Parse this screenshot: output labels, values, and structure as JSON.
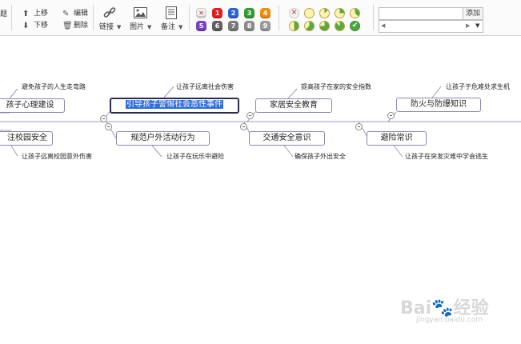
{
  "toolbar": {
    "cut_title": "题",
    "move_up": "上移",
    "move_down": "下移",
    "edit": "编辑",
    "delete": "删除",
    "link": "链接",
    "image": "图片",
    "note": "备注",
    "priorities": [
      {
        "label": "✕",
        "color": "#f0f0f0"
      },
      {
        "label": "1",
        "color": "#e02020"
      },
      {
        "label": "2",
        "color": "#2a63d8"
      },
      {
        "label": "3",
        "color": "#2f9d2f"
      },
      {
        "label": "4",
        "color": "#f08c10"
      },
      {
        "label": "5",
        "color": "#7a3fc8"
      },
      {
        "label": "6",
        "color": "#606060"
      },
      {
        "label": "7",
        "color": "#7a7a7a"
      },
      {
        "label": "8",
        "color": "#8c8c8c"
      },
      {
        "label": "9",
        "color": "#9a9a9a"
      }
    ],
    "progress_levels": [
      0,
      0,
      0.125,
      0.25,
      0.375,
      0.5,
      0.625,
      0.75,
      0.875,
      1
    ],
    "template_add": "添加"
  },
  "mindmap": {
    "nodes": [
      {
        "id": "n1",
        "text": "孩子心理建设"
      },
      {
        "id": "n2",
        "text": "引导孩子警惕社会恶性事件",
        "selected": true
      },
      {
        "id": "n3",
        "text": "家居安全教育"
      },
      {
        "id": "n4",
        "text": "防火与防爆知识"
      },
      {
        "id": "n5",
        "text": "注校园安全"
      },
      {
        "id": "n6",
        "text": "规范户外活动行为"
      },
      {
        "id": "n7",
        "text": "交通安全意识"
      },
      {
        "id": "n8",
        "text": "避险常识"
      }
    ],
    "notes": [
      "避免孩子的人生走弯路",
      "让孩子远离社会伤害",
      "提高孩子在家的安全指数",
      "让孩子于危难处求生机",
      "让孩子远离校园意外伤害",
      "让孩子在玩乐中避险",
      "确保孩子外出安全",
      "让孩子在突发灾难中学会逃生"
    ]
  },
  "watermark": {
    "logo": "Bai度经验",
    "url": "jingyan.baidu.com"
  }
}
